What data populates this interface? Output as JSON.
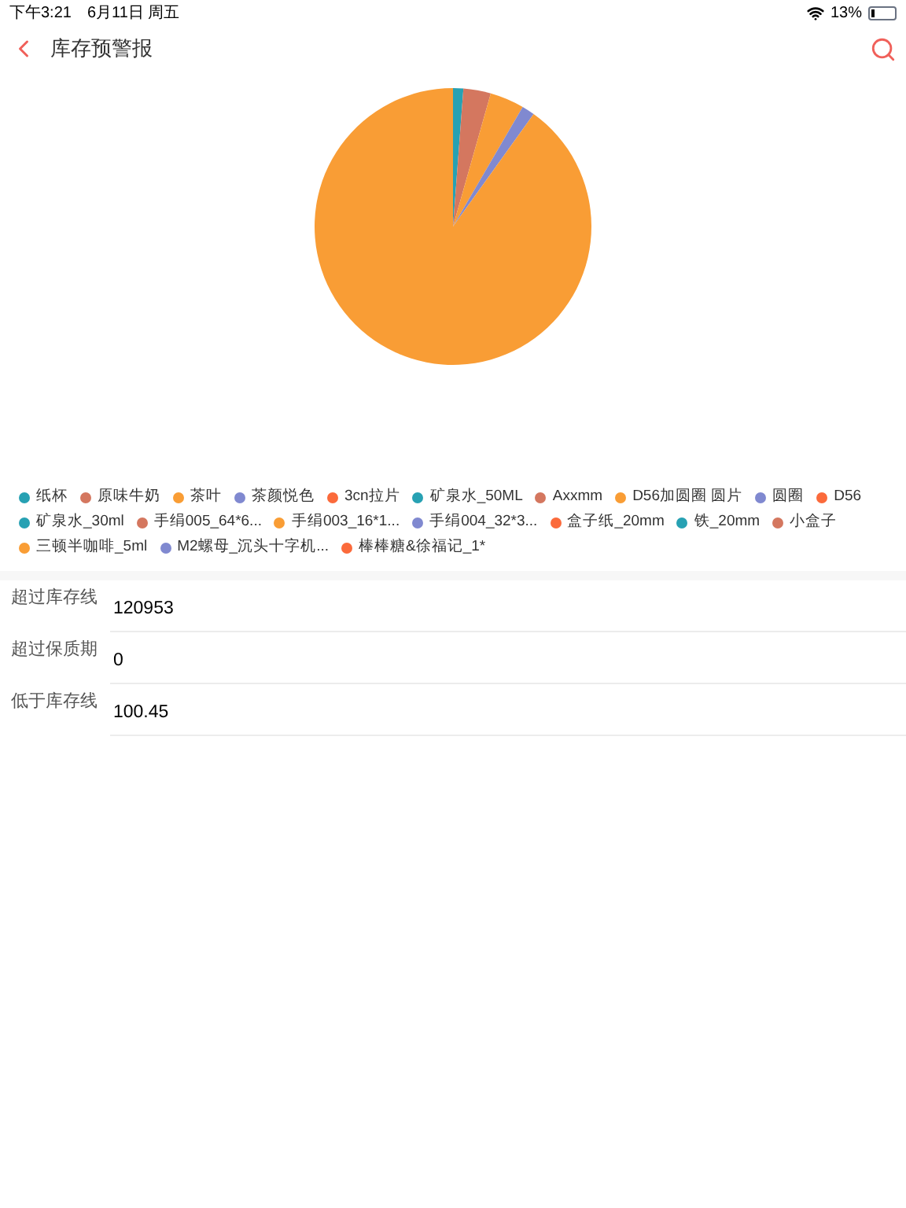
{
  "status_bar": {
    "time": "下午3:21",
    "date": "6月11日 周五",
    "battery": "13%"
  },
  "nav": {
    "title": "库存预警报"
  },
  "legend": [
    {
      "label": "纸杯",
      "color": "#27a1b3"
    },
    {
      "label": "原味牛奶",
      "color": "#d4775f"
    },
    {
      "label": "茶叶",
      "color": "#f99d35"
    },
    {
      "label": "茶颜悦色",
      "color": "#8089d0"
    },
    {
      "label": "3cn拉片",
      "color": "#fb6a3b"
    },
    {
      "label": "矿泉水_50ML",
      "color": "#27a1b3"
    },
    {
      "label": "Axxmm",
      "color": "#d4775f"
    },
    {
      "label": "D56加圆圈 圆片",
      "color": "#f99d35"
    },
    {
      "label": "圆圈",
      "color": "#8089d0"
    },
    {
      "label": "D56",
      "color": "#fb6a3b"
    },
    {
      "label": "矿泉水_30ml",
      "color": "#27a1b3"
    },
    {
      "label": "手绢005_64*6...",
      "color": "#d4775f"
    },
    {
      "label": "手绢003_16*1...",
      "color": "#f99d35"
    },
    {
      "label": "手绢004_32*3...",
      "color": "#8089d0"
    },
    {
      "label": "盒子纸_20mm",
      "color": "#fb6a3b"
    },
    {
      "label": "铁_20mm",
      "color": "#27a1b3"
    },
    {
      "label": "小盒子",
      "color": "#d4775f"
    },
    {
      "label": "三顿半咖啡_5ml",
      "color": "#f99d35"
    },
    {
      "label": "M2螺母_沉头十字机...",
      "color": "#8089d0"
    },
    {
      "label": "棒棒糖&徐福记_1*",
      "color": "#fb6a3b"
    }
  ],
  "rows": [
    {
      "label": "超过库存线",
      "value": "120953"
    },
    {
      "label": "超过保质期",
      "value": "0"
    },
    {
      "label": "低于库存线",
      "value": "100.45"
    }
  ]
}
